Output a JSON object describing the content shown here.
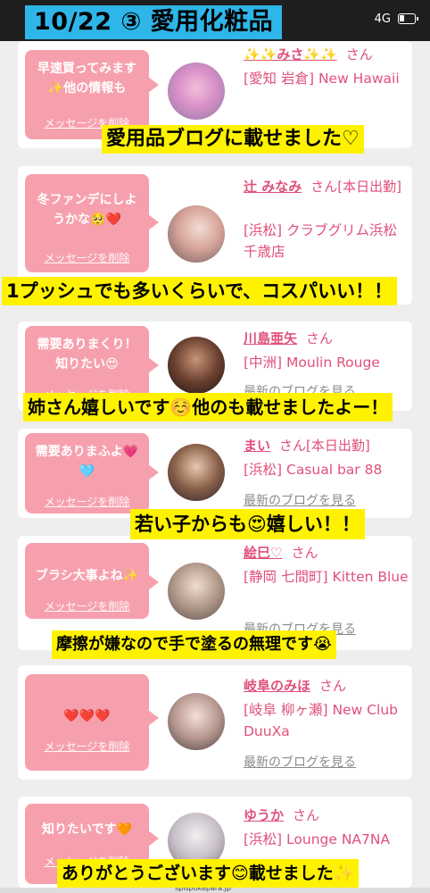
{
  "status": {
    "title": "10/22 ③ 愛用化粧品",
    "network": "4G"
  },
  "delete_label": "メッセージを削除",
  "blog_link_label": "最新のブログを見る",
  "honorific": "さん",
  "cards": [
    {
      "message": "早速買ってみます\n✨他の情報も",
      "name": "✨✨みさ✨✨",
      "shop": "[愛知 岩倉] New Hawaii",
      "blog": ""
    },
    {
      "message": "冬ファンデにしよ\nうかな🥺❤️",
      "name": "辻 みなみ",
      "name_suffix": "[本日出勤]",
      "shop": "[浜松] クラブグリム浜松千歳店",
      "blog": ""
    },
    {
      "message": "需要ありまくり！\n知りたい😍",
      "name": "川島亜矢",
      "shop": "[中洲] Moulin Rouge",
      "blog": "最新のブログを見る"
    },
    {
      "message": "需要ありまふよ💗\n🩵",
      "name": "まい",
      "name_suffix": "[本日出勤]",
      "shop": "[浜松] Casual bar 88",
      "blog": "最新のブログを見る"
    },
    {
      "message": "ブラシ大事よね✨",
      "name": "絵巳♡",
      "shop": "[静岡 七間町] Kitten Blue",
      "blog": "最新のブログを見る"
    },
    {
      "message": "❤️❤️❤️",
      "name": "岐阜のみほ",
      "shop": "[岐阜 柳ヶ瀬] New Club DuuXa",
      "blog": "最新のブログを見る"
    },
    {
      "message": "知りたいです🧡",
      "name": "ゆうか",
      "shop": "[浜松] Lounge NA7NA",
      "blog": ""
    }
  ],
  "captions": [
    "愛用品ブログに載せました♡",
    "1プッシュでも多いくらいで、コスパいい！！",
    "姉さん嬉しいです☺️他のも載せましたよー！",
    "若い子からも😍嬉しい！！",
    "摩擦が嫌なので手で塗るの無理です😭",
    "ありがとうございます😊載せました✨"
  ],
  "footer_url": "spispokepara.jp",
  "colors": {
    "bubble": "#f7a0ad",
    "name": "#e0507a",
    "caption_bg": "#fff200",
    "title_bg": "#2fb6e8"
  }
}
